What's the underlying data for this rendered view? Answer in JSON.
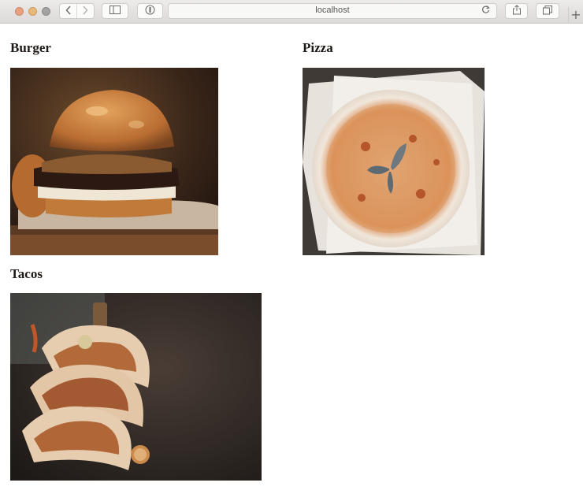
{
  "browser": {
    "url": "localhost",
    "icons": {
      "back": "chevron-left-icon",
      "forward": "chevron-right-icon",
      "sidebar": "sidebar-icon",
      "reader": "reader-icon",
      "reload": "reload-icon",
      "share": "share-icon",
      "tabs": "tabs-icon",
      "new_tab": "plus-icon"
    }
  },
  "foods": [
    {
      "title": "Burger",
      "image": "burger photo"
    },
    {
      "title": "Pizza",
      "image": "pizza photo"
    },
    {
      "title": "Tacos",
      "image": "tacos photo"
    }
  ]
}
